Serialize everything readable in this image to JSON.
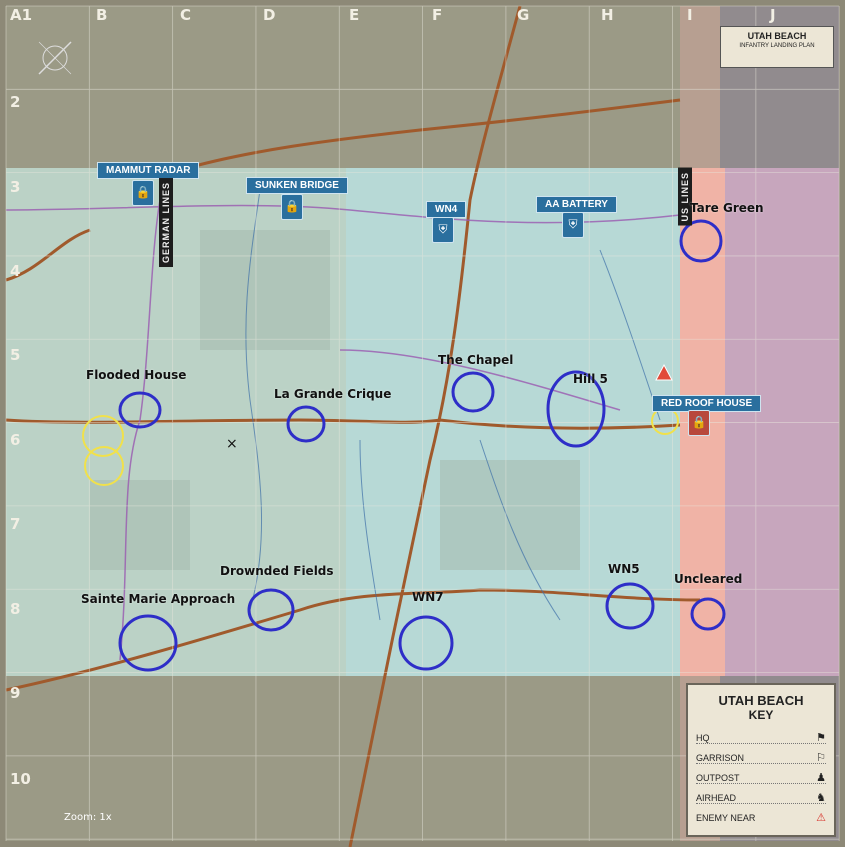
{
  "map": {
    "title": "UTAH BEACH",
    "plan_title": "UTAH BEACH",
    "plan_subtitle": "INFANTRY LANDING PLAN",
    "zoom_text": "Zoom: 1x"
  },
  "grid": {
    "columns": [
      "A1",
      "B",
      "C",
      "D",
      "E",
      "F",
      "G",
      "H",
      "I",
      "J"
    ],
    "rows": [
      "2",
      "3",
      "4",
      "5",
      "6",
      "7",
      "8",
      "9",
      "10"
    ]
  },
  "sector_labels": [
    "MAMMUT RADAR",
    "SUNKEN BRIDGE",
    "WN4",
    "AA BATTERY",
    "RED ROOF HOUSE"
  ],
  "front_lines": [
    "GERMAN LINES",
    "US LINES"
  ],
  "annotations": [
    {
      "label": "Flooded House"
    },
    {
      "label": "La Grande Crique"
    },
    {
      "label": "The Chapel"
    },
    {
      "label": "Hill 5"
    },
    {
      "label": "Tare Green"
    },
    {
      "label": "Drownded Fields"
    },
    {
      "label": "Sainte Marie Approach"
    },
    {
      "label": "WN7"
    },
    {
      "label": "WN5"
    },
    {
      "label": "Uncleared"
    }
  ],
  "key": {
    "title": "UTAH BEACH",
    "subtitle": "KEY",
    "items": [
      "HQ",
      "GARRISON",
      "OUTPOST",
      "AIRHEAD",
      "ENEMY NEAR"
    ]
  },
  "colors": {
    "land": "#aeb8a9",
    "active_area": "#b7d9d6",
    "beach": "#f0b3a6",
    "sea": "#b59ab0",
    "road": "#a05a2c",
    "highlight_circle": "#2e2ec8",
    "sector_banner": "#2a6f9e"
  }
}
